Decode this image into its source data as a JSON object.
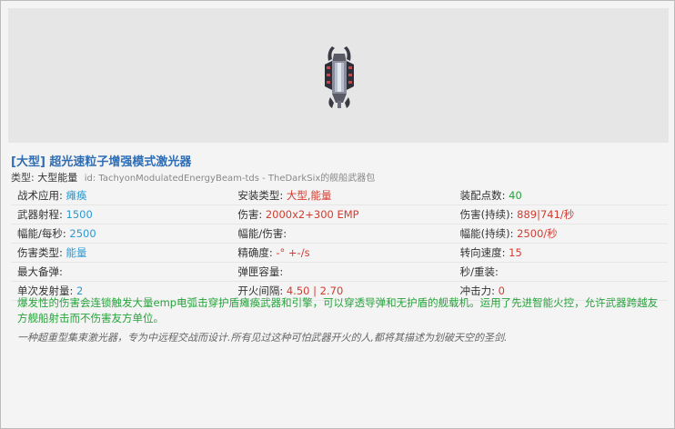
{
  "item": {
    "title": "[大型] 超光速粒子增强模式激光器",
    "type_label": "类型:",
    "type_value": "大型能量",
    "id_text": "id: TachyonModulatedEnergyBeam-tds - TheDarkSix的舰船武器包"
  },
  "stats": [
    [
      {
        "label": "战术应用:",
        "value": "瘫痪",
        "color": "cyan"
      },
      {
        "label": "安装类型:",
        "value": "大型,能量",
        "color": "red"
      },
      {
        "label": "装配点数:",
        "value": "40",
        "color": "green"
      }
    ],
    [
      {
        "label": "武器射程:",
        "value": "1500",
        "color": "cyan"
      },
      {
        "label": "伤害:",
        "value": "2000x2+300 EMP",
        "color": "red"
      },
      {
        "label": "伤害(持续):",
        "value": "889|741/秒",
        "color": "red"
      }
    ],
    [
      {
        "label": "幅能/每秒:",
        "value": "2500",
        "color": "cyan"
      },
      {
        "label": "幅能/伤害:",
        "value": "",
        "color": "dark"
      },
      {
        "label": "幅能(持续):",
        "value": "2500/秒",
        "color": "red"
      }
    ],
    [
      {
        "label": "伤害类型:",
        "value": "能量",
        "color": "cyan"
      },
      {
        "label": "精确度:",
        "value": "-° +-/s",
        "color": "red"
      },
      {
        "label": "转向速度:",
        "value": "15",
        "color": "red"
      }
    ],
    [
      {
        "label": "最大备弹:",
        "value": "",
        "color": "dark"
      },
      {
        "label": "弹匣容量:",
        "value": "",
        "color": "dark"
      },
      {
        "label": "秒/重装:",
        "value": "",
        "color": "dark"
      }
    ],
    [
      {
        "label": "单次发射量:",
        "value": "2",
        "color": "cyan"
      },
      {
        "label": "开火间隔:",
        "value": "4.50 | 2.70",
        "color": "red"
      },
      {
        "label": "冲击力:",
        "value": "0",
        "color": "red"
      }
    ]
  ],
  "description": "爆发性的伤害会连锁触发大量emp电弧击穿护盾瘫痪武器和引擎，可以穿透导弹和无护盾的舰载机。运用了先进智能火控，允许武器跨越友方舰船射击而不伤害友方单位。",
  "lore": "一种超重型集束激光器，专为中远程交战而设计.所有见过这种可怕武器开火的人,都将其描述为划破天空的圣剑.",
  "colors": {
    "cyan": "#2a9ad2",
    "red": "#d33c2f",
    "green": "#27a33c",
    "title": "#2e6db4"
  }
}
